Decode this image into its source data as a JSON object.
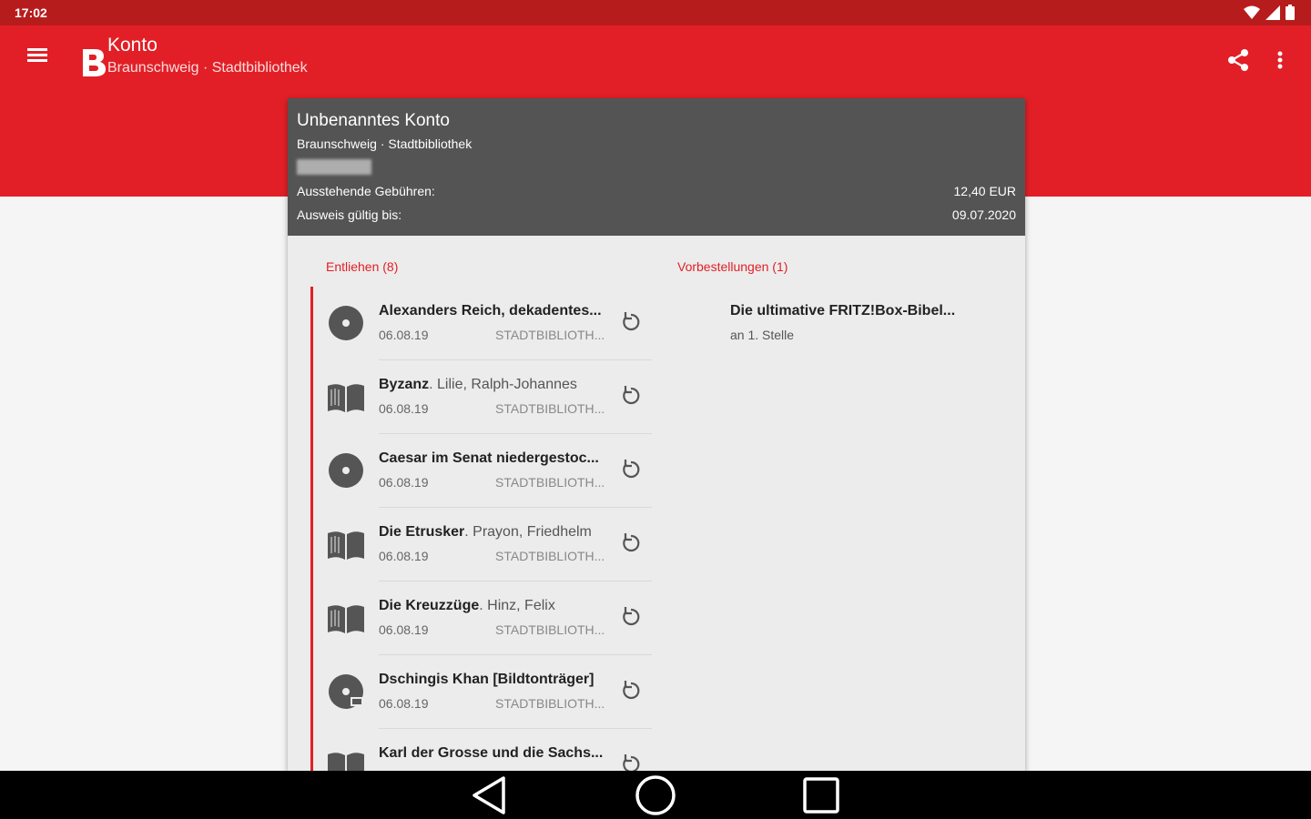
{
  "status_bar": {
    "time": "17:02"
  },
  "app_bar": {
    "title": "Konto",
    "subtitle": "Braunschweig · Stadtbibliothek"
  },
  "account": {
    "name": "Unbenanntes Konto",
    "library": "Braunschweig · Stadtbibliothek",
    "fees_label": "Ausstehende Gebühren:",
    "fees_value": "12,40 EUR",
    "valid_label": "Ausweis gültig bis:",
    "valid_value": "09.07.2020"
  },
  "lent": {
    "header": "Entliehen (8)",
    "items": [
      {
        "icon": "disc-icon",
        "title": "Alexanders Reich, dekadentes...",
        "author": "",
        "date": "06.08.19",
        "branch": "STADTBIBLIOTH..."
      },
      {
        "icon": "book-icon",
        "title": "Byzanz",
        "author": ". Lilie, Ralph-Johannes",
        "date": "06.08.19",
        "branch": "STADTBIBLIOTH..."
      },
      {
        "icon": "disc-icon",
        "title": "Caesar im Senat niedergestoc...",
        "author": "",
        "date": "06.08.19",
        "branch": "STADTBIBLIOTH..."
      },
      {
        "icon": "book-icon",
        "title": "Die Etrusker",
        "author": ". Prayon, Friedhelm",
        "date": "06.08.19",
        "branch": "STADTBIBLIOTH..."
      },
      {
        "icon": "book-icon",
        "title": "Die Kreuzzüge",
        "author": ". Hinz, Felix",
        "date": "06.08.19",
        "branch": "STADTBIBLIOTH..."
      },
      {
        "icon": "video-disc-icon",
        "title": "Dschingis Khan [Bildtonträger]",
        "author": "",
        "date": "06.08.19",
        "branch": "STADTBIBLIOTH..."
      },
      {
        "icon": "book-icon",
        "title": "Karl der Grosse und die Sachs...",
        "author": "",
        "date": "",
        "branch": ""
      }
    ]
  },
  "reservations": {
    "header": "Vorbestellungen (1)",
    "items": [
      {
        "title": "Die ultimative FRITZ!Box-Bibel...",
        "position": "an 1. Stelle"
      }
    ]
  },
  "colors": {
    "primary": "#e21f26",
    "status": "#b71c1c",
    "header": "#545454",
    "card": "#ececec"
  }
}
